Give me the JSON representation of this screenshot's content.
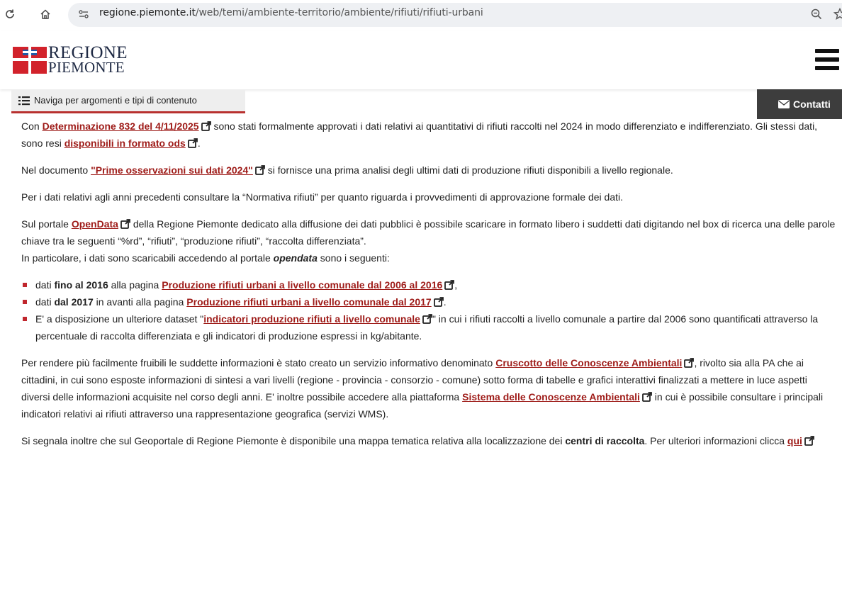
{
  "browser": {
    "url_host": "regione.piemonte.it",
    "url_path": "/web/temi/ambiente-territorio/ambiente/rifiuti/rifiuti-urbani"
  },
  "header": {
    "logo_line1": "REGIONE",
    "logo_line2": "PIEMONTE"
  },
  "nav": {
    "topics_label": "Naviga per argomenti e tipi di contenuto",
    "contacts_label": "Contatti"
  },
  "content": {
    "p1": {
      "t1": "Con ",
      "link1": "Determinazione 832 del 4/11/2025",
      "t2": " sono stati formalmente approvati i dati relativi ai quantitativi di rifiuti raccolti nel 2024 in modo differenziato e indifferenziato. Gli stessi dati, sono resi ",
      "link2": "disponibili in formato ods",
      "t3": "."
    },
    "p2": {
      "t1": "Nel documento ",
      "link1": "\"Prime osservazioni sui dati 2024\"",
      "t2": " si fornisce una prima analisi degli ultimi dati di produzione rifiuti disponibili a livello regionale."
    },
    "p3": "Per i dati relativi agli anni precedenti consultare la “Normativa rifiuti” per quanto riguarda i provvedimenti di approvazione formale dei dati.",
    "p4": {
      "t1": "Sul portale ",
      "link1": "OpenData",
      "t2": " della Regione Piemonte dedicato alla diffusione dei dati pubblici è possibile scaricare in formato libero i suddetti dati digitando nel box di ricerca una delle parole chiave tra le seguenti “%rd”, “rifiuti”, “produzione rifiuti”, “raccolta differenziata”.",
      "t3": "In particolare, i dati sono scaricabili accedendo al portale ",
      "em": "opendata",
      "t4": " sono i seguenti:"
    },
    "list": [
      {
        "t1": "dati ",
        "b": "fino al 2016",
        "t2": " alla pagina ",
        "link": "Produzione rifiuti urbani a livello comunale dal 2006 al 2016",
        "t3": ","
      },
      {
        "t1": "dati ",
        "b": "dal 2017",
        "t2": " in avanti alla pagina ",
        "link": "Produzione rifiuti urbani a livello comunale dal 2017",
        "t3": "."
      },
      {
        "t1": "E' a disposizione un ulteriore dataset \"",
        "link": "indicatori produzione rifiuti a livello comunale",
        "t3": "\" in cui i rifiuti raccolti a livello comunale a partire dal 2006 sono quantificati attraverso la percentuale di raccolta differenziata e gli indicatori di produzione espressi in kg/abitante."
      }
    ],
    "p5": {
      "t1": "Per rendere più facilmente fruibili le suddette informazioni è stato creato un servizio informativo denominato ",
      "link1": "Cruscotto delle Conoscenze Ambientali",
      "t2": ", rivolto sia alla PA che ai cittadini, in cui sono esposte informazioni di sintesi a vari livelli (regione - provincia - consorzio - comune) sotto forma di tabelle e grafici interattivi finalizzati a mettere in luce aspetti diversi delle informazioni acquisite nel corso degli anni. E' inoltre possibile accedere alla piattaforma ",
      "link2": "Sistema delle Conoscenze Ambientali",
      "t3": " in cui è possibile consultare i principali indicatori relativi ai rifiuti attraverso una rappresentazione  geografica (servizi WMS)."
    },
    "p6": {
      "t1": "Si segnala inoltre che sul Geoportale di Regione Piemonte è disponibile una mappa tematica relativa alla localizzazione dei ",
      "b": "centri di raccolta",
      "t2": ". Per ulteriori informazioni clicca ",
      "link1": "qui"
    }
  },
  "colors": {
    "link": "#9e1b18",
    "bullet": "#c0262d",
    "contacts_bg": "#3d3d3d",
    "nav_underline": "#b8312f"
  }
}
